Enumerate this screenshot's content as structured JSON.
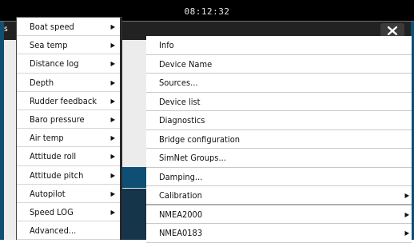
{
  "status_bar": {
    "time": "08:12:32"
  },
  "dialog": {
    "partial_title": "s",
    "close_symbol": "✕"
  },
  "main_list": [
    {
      "label": "Info",
      "has_submenu": false
    },
    {
      "label": "Device Name",
      "has_submenu": false
    },
    {
      "label": "Sources...",
      "has_submenu": false
    },
    {
      "label": "Device list",
      "has_submenu": false
    },
    {
      "label": "Diagnostics",
      "has_submenu": false
    },
    {
      "label": "Bridge configuration",
      "has_submenu": false
    },
    {
      "label": "SimNet Groups...",
      "has_submenu": false
    },
    {
      "label": "Damping...",
      "has_submenu": false
    },
    {
      "label": "Calibration",
      "has_submenu": true
    },
    {
      "label": "NMEA2000",
      "has_submenu": true
    },
    {
      "label": "NMEA0183",
      "has_submenu": true
    }
  ],
  "context_menu": [
    {
      "label": "Boat speed",
      "has_submenu": true
    },
    {
      "label": "Sea temp",
      "has_submenu": true
    },
    {
      "label": "Distance log",
      "has_submenu": true
    },
    {
      "label": "Depth",
      "has_submenu": true
    },
    {
      "label": "Rudder feedback",
      "has_submenu": true
    },
    {
      "label": "Baro pressure",
      "has_submenu": true
    },
    {
      "label": "Air temp",
      "has_submenu": true
    },
    {
      "label": "Attitude roll",
      "has_submenu": true
    },
    {
      "label": "Attitude pitch",
      "has_submenu": true
    },
    {
      "label": "Autopilot",
      "has_submenu": true
    },
    {
      "label": "Speed LOG",
      "has_submenu": true
    },
    {
      "label": "Advanced...",
      "has_submenu": false
    }
  ],
  "icons": {
    "submenu_arrow": "triangle-right-icon",
    "close": "close-icon"
  },
  "colors": {
    "status_bar": "#000000",
    "header": "#222222",
    "accent": "#0e4f73"
  }
}
